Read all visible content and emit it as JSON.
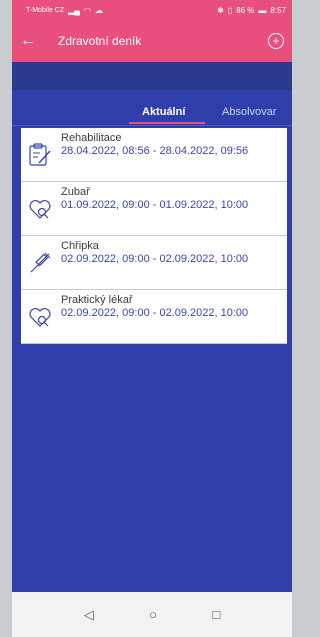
{
  "status": {
    "carrier": "T-Mobile CZ",
    "battery": "86 %",
    "time": "8:57"
  },
  "header": {
    "title": "Zdravotní deník"
  },
  "tabs": [
    {
      "label": "Aktuální"
    },
    {
      "label": "Absolvovar"
    }
  ],
  "entries": [
    {
      "name": "Rehabilitace",
      "date": "28.04.2022, 08:56 - 28.04.2022, 09:56",
      "icon": "clipboard-pen-icon"
    },
    {
      "name": "Zubař",
      "date": "01.09.2022, 09:00 - 01.09.2022, 10:00",
      "icon": "heart-search-icon"
    },
    {
      "name": "Chřipka",
      "date": "02.09.2022, 09:00 - 02.09.2022, 10:00",
      "icon": "syringe-icon"
    },
    {
      "name": "Praktický lékař",
      "date": "02.09.2022, 09:00 - 02.09.2022, 10:00",
      "icon": "heart-search-icon"
    }
  ],
  "colors": {
    "accent": "#e84f7d",
    "background": "#2f3eaa",
    "date_text": "#3a46ab"
  }
}
